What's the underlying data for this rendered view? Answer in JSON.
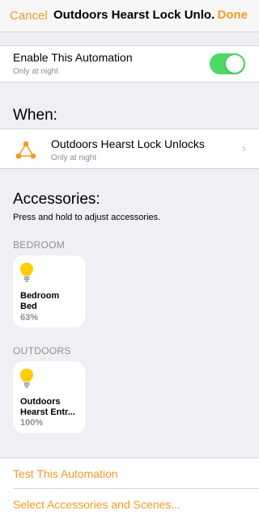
{
  "navbar": {
    "cancel_label": "Cancel",
    "title": "Outdoors Hearst Lock Unlo...",
    "done_label": "Done"
  },
  "enable": {
    "title": "Enable This Automation",
    "subtitle": "Only at night",
    "toggle_on": true
  },
  "when": {
    "header": "When:",
    "trigger_title": "Outdoors Hearst Lock Unlocks",
    "trigger_subtitle": "Only at night"
  },
  "accessories": {
    "header": "Accessories:",
    "hint": "Press and hold to adjust accessories.",
    "groups": [
      {
        "label": "BEDROOM",
        "tile": {
          "name_line1": "Bedroom",
          "name_line2": "Bed",
          "state": "63%"
        }
      },
      {
        "label": "OUTDOORS",
        "tile": {
          "name_line1": "Outdoors",
          "name_line2": "Hearst Entr...",
          "state": "100%"
        }
      }
    ]
  },
  "actions": {
    "test_label": "Test This Automation",
    "select_label": "Select Accessories and Scenes..."
  },
  "colors": {
    "accent": "#f59a23",
    "toggle_on": "#4cd964",
    "bulb": "#ffcc00",
    "background": "#efeff4"
  },
  "icons": [
    "chevron-right-icon",
    "trigger-automation-icon",
    "lightbulb-icon"
  ]
}
